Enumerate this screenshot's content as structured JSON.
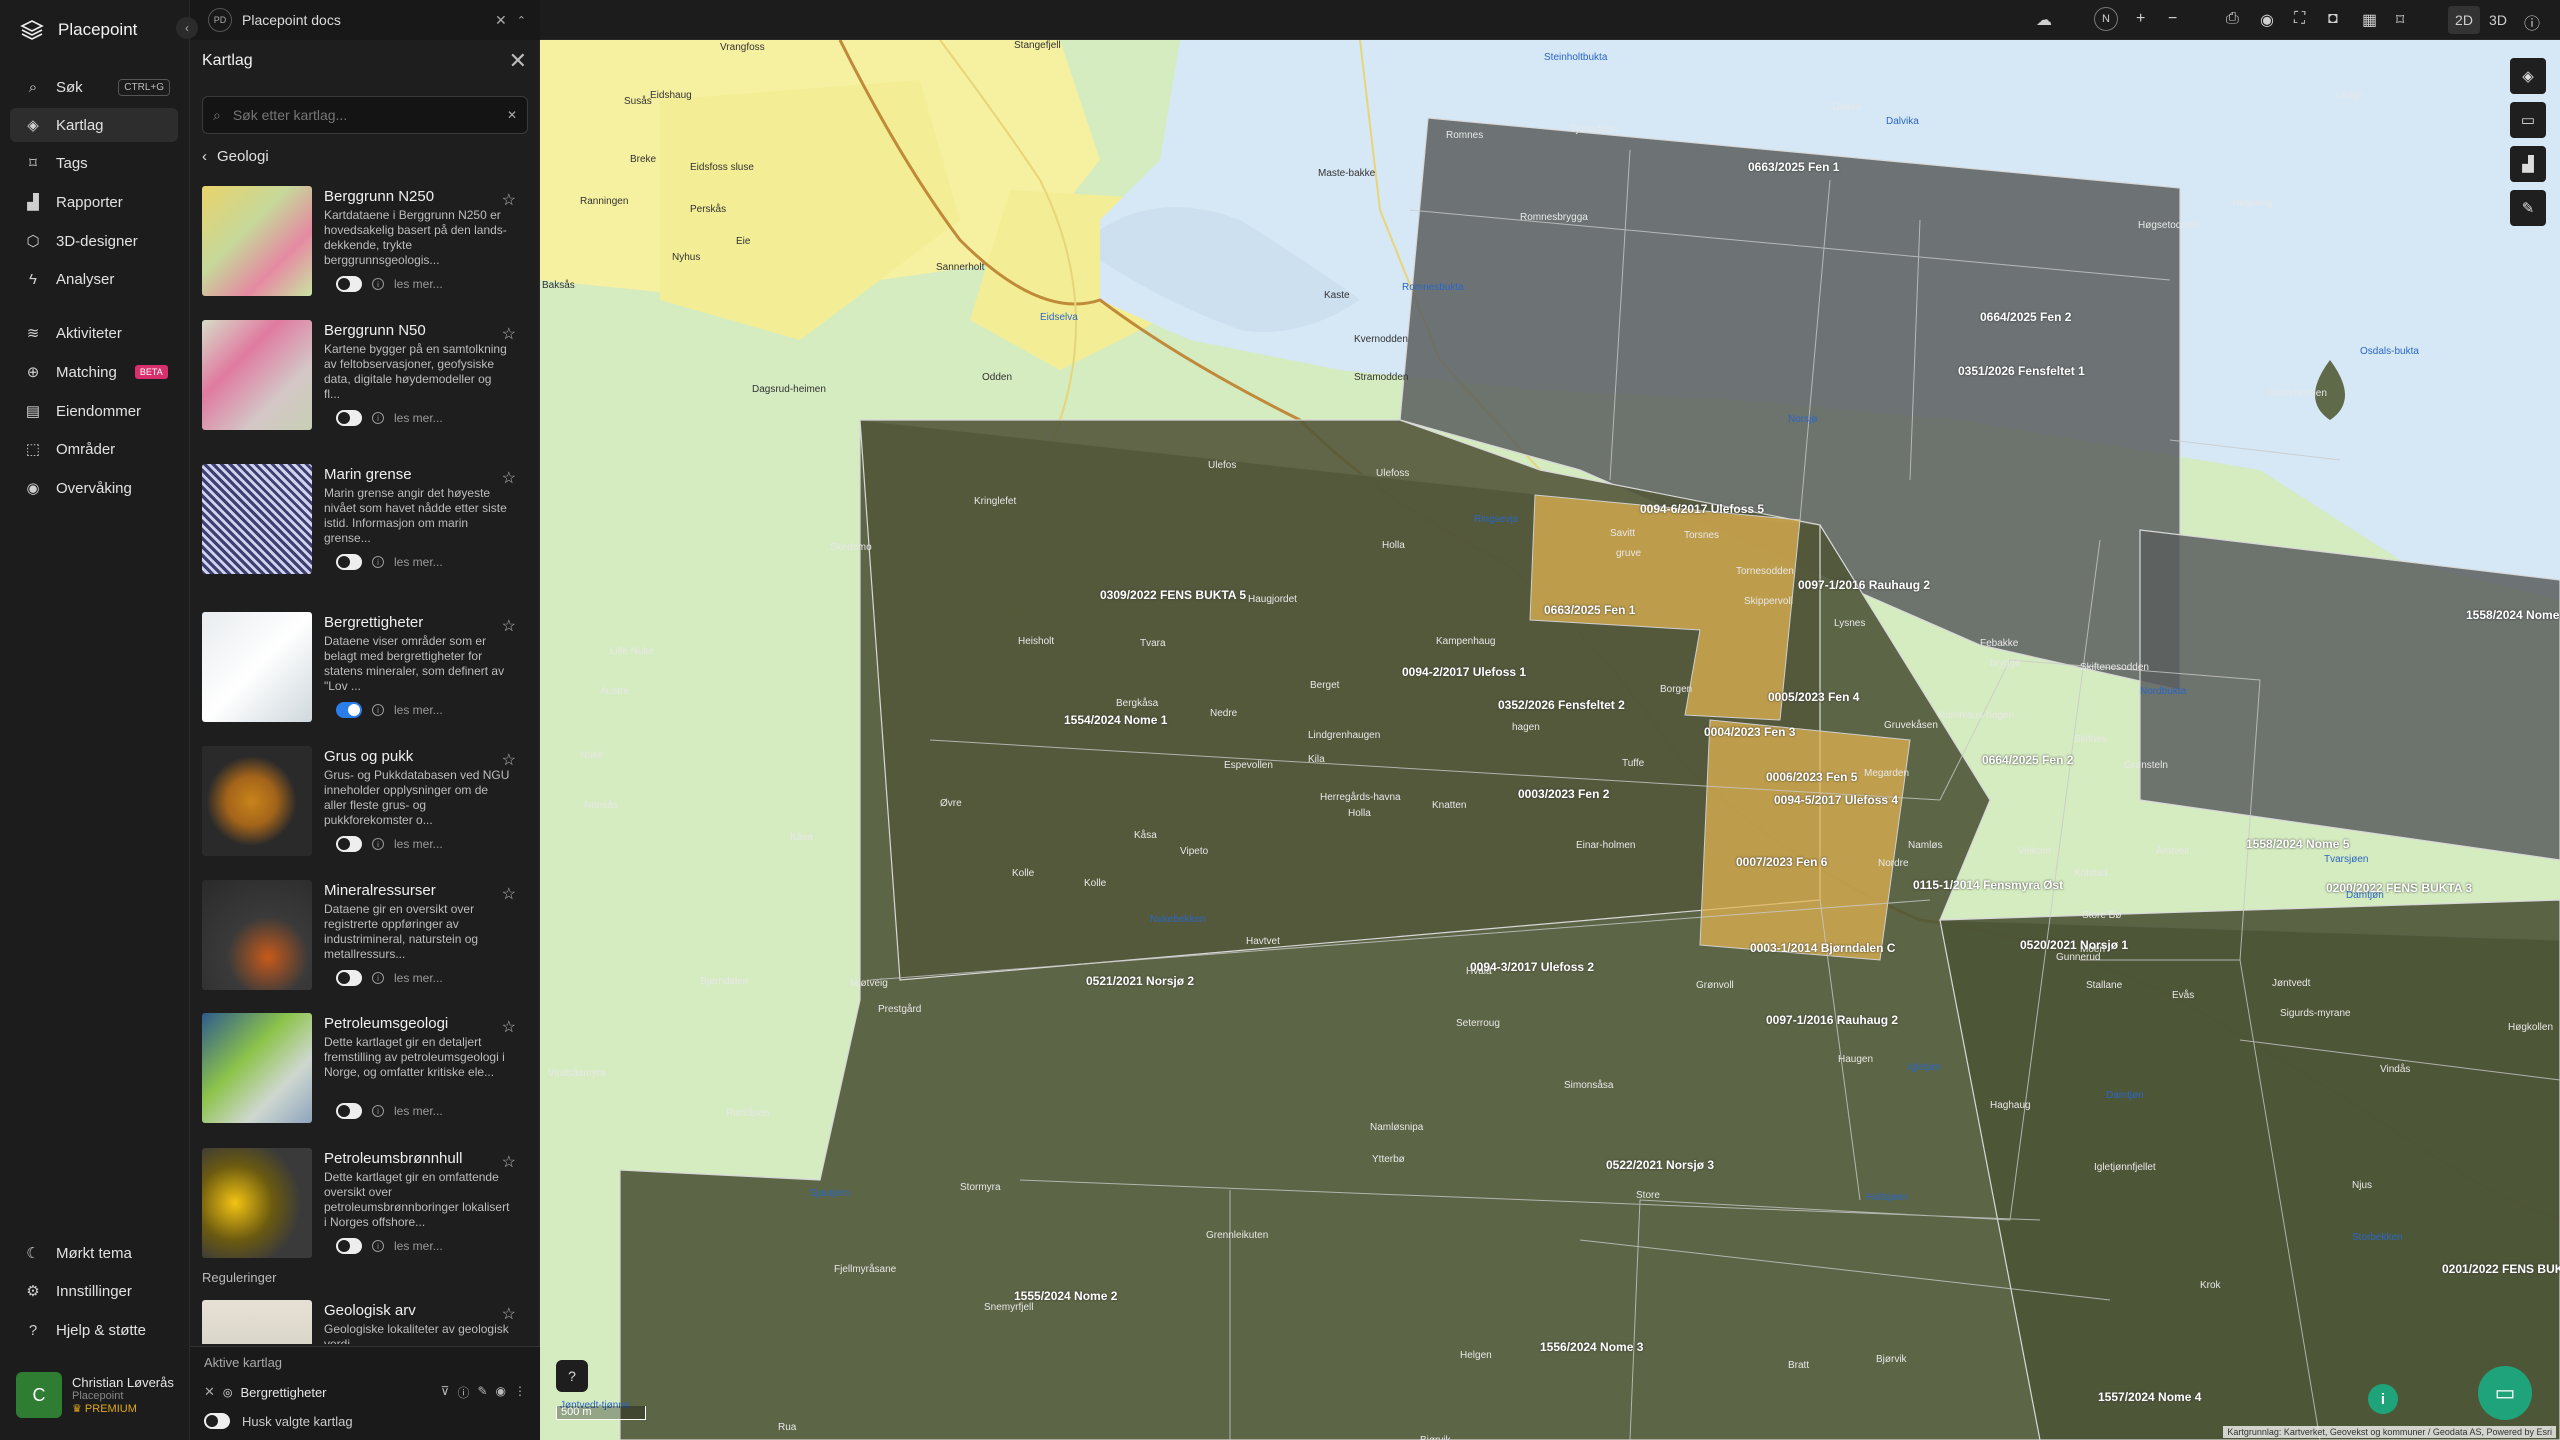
{
  "app": {
    "name": "Placepoint"
  },
  "doc_tab": {
    "badge": "PD",
    "title": "Placepoint docs"
  },
  "nav": {
    "items": [
      {
        "label": "Søk",
        "icon": "search-icon",
        "shortcut": "CTRL+G"
      },
      {
        "label": "Kartlag",
        "icon": "layers-icon",
        "active": true
      },
      {
        "label": "Tags",
        "icon": "bookmark-icon"
      },
      {
        "label": "Rapporter",
        "icon": "chart-icon"
      },
      {
        "label": "3D-designer",
        "icon": "cube-icon"
      },
      {
        "label": "Analyser",
        "icon": "bolt-icon"
      },
      {
        "label": "Aktiviteter",
        "icon": "activity-icon"
      },
      {
        "label": "Matching",
        "icon": "matching-icon",
        "badge": "BETA"
      },
      {
        "label": "Eiendommer",
        "icon": "building-icon"
      },
      {
        "label": "Områder",
        "icon": "area-icon"
      },
      {
        "label": "Overvåking",
        "icon": "monitor-icon"
      }
    ],
    "bottom": [
      {
        "label": "Mørkt tema",
        "icon": "moon-icon"
      },
      {
        "label": "Innstillinger",
        "icon": "gear-icon"
      },
      {
        "label": "Hjelp & støtte",
        "icon": "help-icon"
      }
    ],
    "user": {
      "initial": "C",
      "name": "Christian Løverås",
      "org": "Placepoint",
      "plan": "PREMIUM"
    }
  },
  "panel": {
    "title": "Kartlag",
    "search_placeholder": "Søk etter kartlag...",
    "breadcrumb": "Geologi",
    "layers": [
      {
        "name": "Berggrunn N250",
        "desc": "Kartdataene i Berggrunn N250 er hovedsakelig basert på den lands-dekkende, trykte berggrunnsgeologis...",
        "more": "les mer...",
        "on": false
      },
      {
        "name": "Berggrunn N50",
        "desc": "Kartene bygger på en samtolkning av feltobservasjoner, geofysiske data, digitale høydemodeller og fl...",
        "more": "les mer...",
        "on": false
      },
      {
        "name": "Marin grense",
        "desc": "Marin grense angir det høyeste nivået som havet nådde etter siste istid. Informasjon om marin grense...",
        "more": "les mer...",
        "on": false
      },
      {
        "name": "Bergrettigheter",
        "desc": "Dataene viser områder som er belagt med bergrettigheter for statens mineraler, som definert av \"Lov ...",
        "more": "les mer...",
        "on": true
      },
      {
        "name": "Grus og pukk",
        "desc": "Grus- og Pukkdatabasen ved NGU inneholder opplysninger om de aller fleste grus- og pukkforekomster o...",
        "more": "les mer...",
        "on": false
      },
      {
        "name": "Mineralressurser",
        "desc": "Dataene gir en oversikt over registrerte oppføringer av industrimineral, naturstein og metallressurs...",
        "more": "les mer...",
        "on": false
      },
      {
        "name": "Petroleumsgeologi",
        "desc": "Dette kartlaget gir en detaljert fremstilling av petroleumsgeologi i Norge, og omfatter kritiske ele...",
        "more": "les mer...",
        "on": false
      },
      {
        "name": "Petroleumsbrønnhull",
        "desc": "Dette kartlaget gir en omfattende oversikt over petroleumsbrønnboringer lokalisert i Norges offshore...",
        "more": "les mer...",
        "on": false
      }
    ],
    "section": "Reguleringer",
    "extra_layer": {
      "name": "Geologisk arv",
      "desc": "Geologiske lokaliteter av geologisk verdi"
    },
    "active": {
      "title": "Aktive kartlag",
      "layer": "Bergrettigheter",
      "remember": "Husk valgte kartlag"
    }
  },
  "toolbar": {
    "mode_2d": "2D",
    "mode_3d": "3D",
    "compass": "N"
  },
  "map": {
    "scale": "500 m",
    "attribution": "Kartgrunnlag: Kartverket, Geovekst og kommuner / Geodata AS, Powered by Esri",
    "rights": [
      "0663/2025 Fen 1",
      "0664/2025 Fen 2",
      "0351/2026 Fensfeltet 1",
      "0094-6/2017 Ulefoss 5",
      "0097-1/2016 Rauhaug 2",
      "1558/2024 Nome",
      "0309/2022 FENS BUKTA 5",
      "0663/2025 Fen 1",
      "0094-2/2017 Ulefoss 1",
      "0352/2026 Fensfeltet 2",
      "0005/2023 Fen 4",
      "1554/2024 Nome 1",
      "0004/2023 Fen 3",
      "0664/2025 Fen 2",
      "0006/2023 Fen 5",
      "0003/2023 Fen 2",
      "0094-5/2017 Ulefoss 4",
      "1558/2024 Nome 5",
      "0007/2023 Fen 6",
      "0115-1/2014 Fensmyra Øst",
      "0200/2022 FENS BUKTA 3",
      "0003-1/2014 Bjørndalen C",
      "0520/2021 Norsjø 1",
      "0521/2021 Norsjø 2",
      "0094-3/2017 Ulefoss 2",
      "0097-1/2016 Rauhaug 2",
      "0522/2021 Norsjø 3",
      "1555/2024 Nome 2",
      "1556/2024 Nome 3",
      "1557/2024 Nome 4",
      "0201/2022 FENS BUKTA"
    ],
    "places": [
      "Steinholtbukta",
      "Stangefjell",
      "Vrangfoss",
      "Galten",
      "Dalvika",
      "Eidshaug",
      "Susås",
      "Romnes",
      "Tjonodden",
      "Lango",
      "Breke",
      "Eidsfoss sluse",
      "Maste-bakke",
      "Ranningen",
      "Perskås",
      "Romnesbrygga",
      "Høgsetodden",
      "Nyhus",
      "Eie",
      "Sannerholt",
      "Romnesbukta",
      "Høgskog",
      "Osdals-bukta",
      "Baksås",
      "Kaste",
      "Kvernodden",
      "Odden",
      "Eidselva",
      "Stramodden",
      "Osdalholmen",
      "Dagsrud-heimen",
      "Norsjø",
      "Ulefos",
      "Ulefoss",
      "Kringlefet",
      "Holla",
      "Ringsevja",
      "Savitt",
      "gruve",
      "Tornesodden",
      "Torsnes",
      "Skedsmo",
      "Haugjordet",
      "Skippervoll",
      "Lysnes",
      "Febakke",
      "brygge",
      "Lille Nuke",
      "Heisholt",
      "Tvara",
      "Berget",
      "Kampenhaug",
      "Borgen",
      "Skiftenesodden",
      "Nordbukta",
      "Austre",
      "Bergkåsa",
      "Nedre",
      "Lindgrenhaugen",
      "hagen",
      "Gruvekåsen",
      "Namnlaus-hagen",
      "Skifnes",
      "Nuke",
      "Espevollen",
      "Kila",
      "Tuffe",
      "Megarden",
      "Kåsa",
      "Grønsteln",
      "Nonsås",
      "Øvre",
      "Herregårds-havna",
      "Holla",
      "Knatten",
      "Kåsa",
      "Vipeto",
      "Einar-holmen",
      "Namløs",
      "Nordre",
      "Velkom",
      "Kolstad",
      "Åmtveit",
      "Tvarsjøen",
      "Damtjøn",
      "Kolle",
      "Kolle",
      "Store Bø",
      "Moen",
      "Gunnerud",
      "Stallane",
      "Nukebekken",
      "Havtvet",
      "Bjørndalen",
      "Mjøtveig",
      "Prestgård",
      "Hvala",
      "Grønvoll",
      "Seterroug",
      "Jøntvedt",
      "Evås",
      "Sigurds-myrane",
      "Høgkollen",
      "Haugen",
      "Igletjøn",
      "Haghaug",
      "Damtjøn",
      "Vindås",
      "Vindsåsmyra",
      "Ristilåsen",
      "Namløsnipa",
      "Simonsåsa",
      "Ytterbø",
      "Sjautjern",
      "Stormyra",
      "Store",
      "Holtsjøen",
      "Igletjønnfjellet",
      "Njus",
      "Fjellmyråsane",
      "Grennleikuten",
      "Krok",
      "Snemyrfjell",
      "Helgen",
      "Bjørvik",
      "Bratt",
      "Jøntvedt-tjønna",
      "Rua",
      "Bjørvik",
      "Storbekken"
    ]
  },
  "colors": {
    "accent": "#2b7de9",
    "beta": "#d8306c",
    "premium": "#e0a81a",
    "chat": "#1fa37b",
    "rights_fill": "#4f5637",
    "rights_highlight": "#e6b652"
  }
}
